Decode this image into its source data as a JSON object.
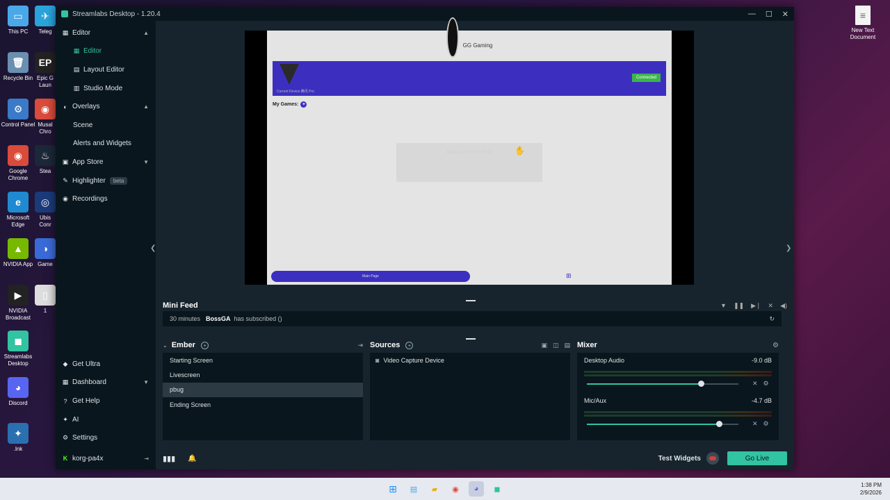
{
  "desktop_icons": [
    {
      "label": "This PC",
      "glyph": "▭",
      "color": "#4aa8e8"
    },
    {
      "label": "Recycle Bin",
      "glyph": "🗑",
      "color": "#6a8fb0"
    },
    {
      "label": "Control Panel",
      "glyph": "⚙",
      "color": "#3a7ac8"
    },
    {
      "label": "Google Chrome",
      "glyph": "◉",
      "color": "#d94b3b"
    },
    {
      "label": "Microsoft Edge",
      "glyph": "e",
      "color": "#1f8ad2"
    },
    {
      "label": "NVIDIA App",
      "glyph": "▲",
      "color": "#76b900"
    },
    {
      "label": "NVIDIA Broadcast",
      "glyph": "▶",
      "color": "#222"
    },
    {
      "label": "Streamlabs Desktop",
      "glyph": "◼",
      "color": "#31c3a2"
    },
    {
      "label": "Discord",
      "glyph": "◕",
      "color": "#5865f2"
    },
    {
      "label": ".lnk",
      "glyph": "✦",
      "color": "#2a6fb0"
    }
  ],
  "desktop_icons_col2": [
    {
      "label": "Teleg",
      "glyph": "✈",
      "color": "#2aa3db"
    },
    {
      "label": "Epic G Laun",
      "glyph": "EP",
      "color": "#222"
    },
    {
      "label": "Musal Chro",
      "glyph": "◉",
      "color": "#d94b3b"
    },
    {
      "label": "Stea",
      "glyph": "♨",
      "color": "#1b2838"
    },
    {
      "label": "Ubis Conr",
      "glyph": "◎",
      "color": "#1a3a7a"
    },
    {
      "label": "Game",
      "glyph": "◑",
      "color": "#3a6ad8"
    },
    {
      "label": "1",
      "glyph": "▯",
      "color": "#ddd"
    }
  ],
  "desktop_right_icon": {
    "label": "New Text Document",
    "glyph": "📄"
  },
  "window": {
    "title": "Streamlabs Desktop - 1.20.4",
    "minimize": "—",
    "maximize": "☐",
    "close": "✕"
  },
  "sidebar": {
    "items": [
      {
        "label": "Editor",
        "icon": "editor-icon",
        "glyph": "▦",
        "chevron": "▲",
        "level": "top"
      },
      {
        "label": "Editor",
        "icon": "editor-icon",
        "glyph": "▦",
        "level": "sub",
        "active": true
      },
      {
        "label": "Layout Editor",
        "icon": "layout-icon",
        "glyph": "▤",
        "level": "sub"
      },
      {
        "label": "Studio Mode",
        "icon": "studio-icon",
        "glyph": "▥",
        "level": "sub"
      },
      {
        "label": "Overlays",
        "icon": "overlays-icon",
        "glyph": "◐",
        "chevron": "▲",
        "level": "top"
      },
      {
        "label": "Scene",
        "level": "sub"
      },
      {
        "label": "Alerts and Widgets",
        "level": "sub"
      },
      {
        "label": "App Store",
        "icon": "store-icon",
        "glyph": "▣",
        "chevron": "▼",
        "level": "top"
      },
      {
        "label": "Highlighter",
        "icon": "highlighter-icon",
        "glyph": "✎",
        "badge": "beta",
        "level": "top"
      },
      {
        "label": "Recordings",
        "icon": "recordings-icon",
        "glyph": "◉",
        "level": "top"
      }
    ],
    "bottom_items": [
      {
        "label": "Get Ultra",
        "icon": "ultra-icon",
        "glyph": "◆"
      },
      {
        "label": "Dashboard",
        "icon": "dashboard-icon",
        "glyph": "▦",
        "chevron": "▼"
      },
      {
        "label": "Get Help",
        "icon": "help-icon",
        "glyph": "?"
      },
      {
        "label": "AI",
        "icon": "ai-icon",
        "glyph": "✦"
      },
      {
        "label": "Settings",
        "icon": "settings-icon",
        "glyph": "⚙"
      }
    ],
    "user": {
      "label": "korg-pa4x",
      "logout_glyph": "⇥"
    }
  },
  "preview": {
    "brand": "GG Gaming",
    "connected": "Connected",
    "device_text": "Current Device 腾讯 Pro",
    "my_games": "My Games:",
    "ghost_text": "Allow access to files?",
    "main_page": "Main Page"
  },
  "mini_feed": {
    "title": "Mini Feed",
    "event": {
      "time": "30 minutes",
      "user": "BossGA",
      "action": "has subscribed ()"
    }
  },
  "scenes": {
    "title": "Ember",
    "items": [
      "Starting Screen",
      "Livescreen",
      "pbug",
      "Ending Screen"
    ],
    "selected": 2
  },
  "sources": {
    "title": "Sources",
    "items": [
      {
        "label": "Video Capture Device",
        "icon": "webcam-icon"
      }
    ]
  },
  "mixer": {
    "title": "Mixer",
    "channels": [
      {
        "name": "Desktop Audio",
        "db": "-9.0 dB",
        "level": 0.75
      },
      {
        "name": "Mic/Aux",
        "db": "-4.7 dB",
        "level": 0.87
      }
    ]
  },
  "footer": {
    "test_widgets": "Test Widgets",
    "go_live": "Go Live"
  },
  "taskbar": {
    "time": "1:38 PM",
    "date": "2/9/2026"
  }
}
